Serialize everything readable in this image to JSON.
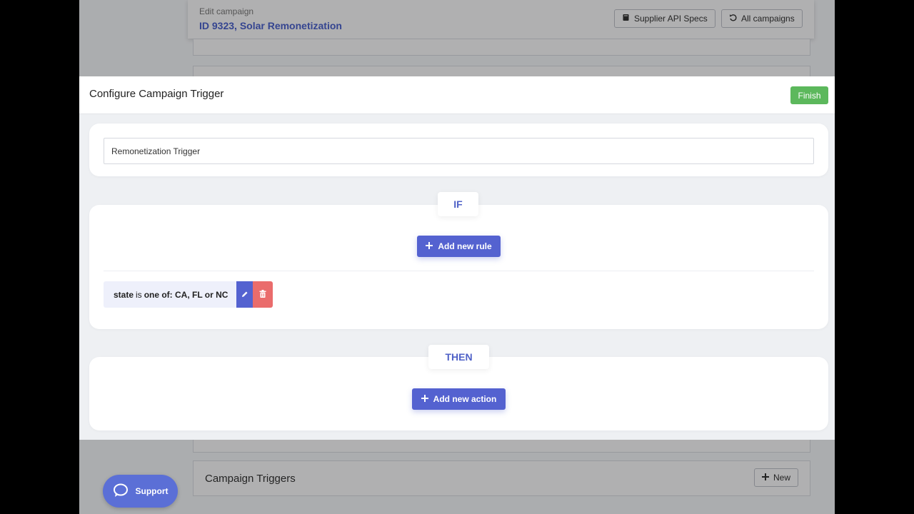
{
  "background": {
    "header_subtitle": "Edit campaign",
    "header_title": "ID 9323, Solar Remonetization",
    "supplier_api_specs_label": "Supplier API Specs",
    "all_campaigns_label": "All campaigns",
    "campaign_triggers_title": "Campaign Triggers",
    "new_label": "New",
    "support_label": "Support"
  },
  "modal": {
    "title": "Configure Campaign Trigger",
    "finish_label": "Finish",
    "trigger_name_value": "Remonetization Trigger",
    "if_label": "IF",
    "add_rule_label": "Add new rule",
    "rule": {
      "field": "state",
      "operator": "is",
      "condition": "one of: CA, FL or NC"
    },
    "then_label": "THEN",
    "add_action_label": "Add new action"
  },
  "colors": {
    "primary": "#5462d0",
    "success": "#5cb85c",
    "danger": "#ea6c6c",
    "link_title": "#4a60c8"
  }
}
